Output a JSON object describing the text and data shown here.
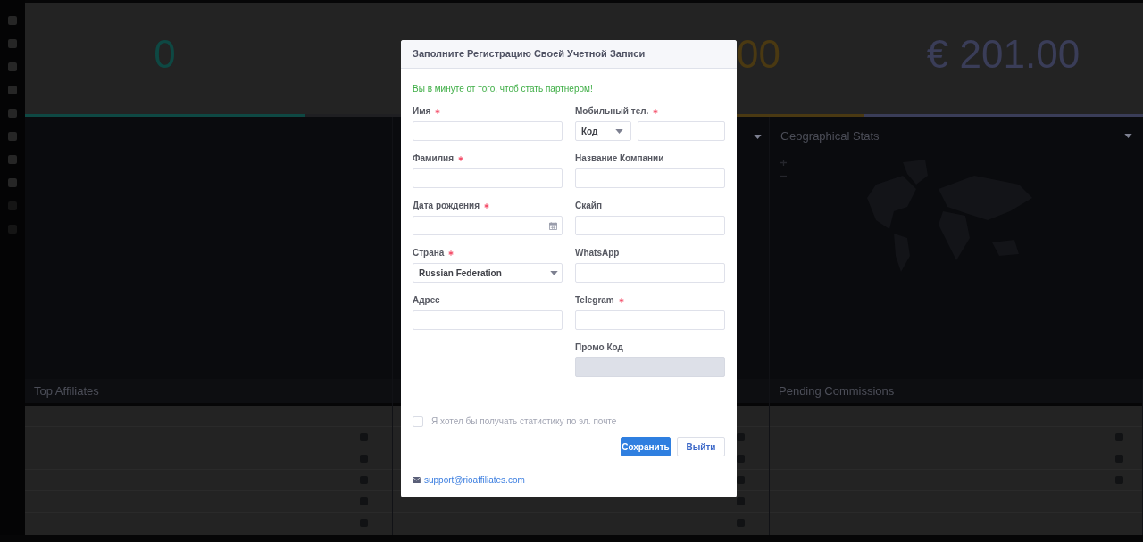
{
  "stats": [
    {
      "kind": "full",
      "value": "0",
      "color": "#0e4843"
    },
    {
      "kind": "partial",
      "value": "00",
      "color": "#4a3912"
    },
    {
      "kind": "full",
      "value": "€ 201.00",
      "color": "#3a3d58"
    }
  ],
  "geo_panel": {
    "title": "Geographical Stats"
  },
  "tables": [
    {
      "title": "Top Affiliates"
    },
    {
      "title": "Pending Commissions"
    }
  ],
  "modal": {
    "title": "Заполните Регистрацию Своей Учетной Записи",
    "intro": "Вы в минуте от того, чтоб стать партнером!",
    "left_fields": [
      {
        "label": "Имя",
        "required": true,
        "disabled": false,
        "kind": "text"
      },
      {
        "label": "Фамилия",
        "required": true,
        "disabled": false,
        "kind": "text"
      },
      {
        "label": "Дата рождения",
        "required": true,
        "disabled": false,
        "kind": "date"
      },
      {
        "label": "Страна",
        "required": true,
        "disabled": false,
        "kind": "select",
        "value": "Russian Federation"
      },
      {
        "label": "Адрес",
        "required": false,
        "disabled": false,
        "kind": "text"
      }
    ],
    "right_fields": [
      {
        "label": "Мобильный тел.",
        "required": true,
        "disabled": false,
        "kind": "phone",
        "code_value": "Код"
      },
      {
        "label": "Название Компании",
        "required": false,
        "disabled": false,
        "kind": "text"
      },
      {
        "label": "Скайп",
        "required": false,
        "disabled": false,
        "kind": "text"
      },
      {
        "label": "WhatsApp",
        "required": false,
        "disabled": false,
        "kind": "text"
      },
      {
        "label": "Telegram",
        "required": true,
        "disabled": false,
        "kind": "text"
      },
      {
        "label": "Промо Код",
        "required": false,
        "disabled": true,
        "kind": "text"
      }
    ],
    "checkbox": {
      "label": "Я хотел бы получать статистику по эл. почте",
      "checked": false
    },
    "buttons": [
      {
        "label": "Сохранить",
        "kind": "primary"
      },
      {
        "label": "Выйти",
        "kind": "secondary"
      }
    ],
    "support_email": "support@rioaffiliates.com"
  }
}
